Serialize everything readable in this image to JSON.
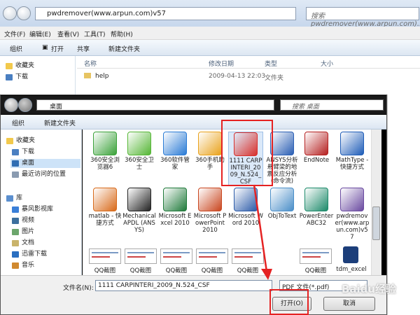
{
  "back_window": {
    "address": "pwdremover(www.arpun.com)v57",
    "search_placeholder": "搜索 pwdremover(www.arpun.com)...",
    "menu": [
      "文件(F)",
      "编辑(E)",
      "查看(V)",
      "工具(T)",
      "帮助(H)"
    ],
    "toolbar": {
      "organize": "组织",
      "open": "打开",
      "share": "共享",
      "new_folder": "新建文件夹"
    },
    "sidebar": [
      "收藏夹",
      "下载"
    ],
    "columns": {
      "name": "名称",
      "modified": "修改日期",
      "type": "类型",
      "size": "大小"
    },
    "rows": [
      {
        "name": "help",
        "modified": "2009-04-13 22:03",
        "type": "文件夹"
      }
    ]
  },
  "dialog": {
    "address": "桌面",
    "search_placeholder": "搜索 桌面",
    "toolbar": {
      "organize": "组织",
      "new_folder": "新建文件夹"
    },
    "sidebar": {
      "favorites_title": "收藏夹",
      "favorites": [
        "下载",
        "桌面",
        "最近访问的位置"
      ],
      "library_title": "库",
      "libraries": [
        "暴风影视库",
        "视频",
        "图片",
        "文档",
        "迅雷下载",
        "音乐"
      ]
    },
    "items": [
      {
        "label": "360安全浏览器6",
        "color": "#3ba23a"
      },
      {
        "label": "360安全卫士",
        "color": "#55b635"
      },
      {
        "label": "360软件管家",
        "color": "#2a7bd5"
      },
      {
        "label": "360手机助手",
        "color": "#e9a21c"
      },
      {
        "label": "1111 CARPINTERI_2009_N.524_CSF",
        "color": "#d8302c"
      },
      {
        "label": "ANSYS分析悬臂梁的地震反应分析(命令流)",
        "color": "#2b5fb4"
      },
      {
        "label": "EndNote",
        "color": "#b52020"
      },
      {
        "label": "MathType - 快捷方式",
        "color": "#1f5db8"
      },
      {
        "label": "matlab - 快捷方式",
        "color": "#d86a1a"
      },
      {
        "label": "Mechanical APDL (ANSYS)",
        "color": "#222222"
      },
      {
        "label": "Microsoft Excel 2010",
        "color": "#1f7a3a"
      },
      {
        "label": "Microsoft PowerPoint 2010",
        "color": "#c9461f"
      },
      {
        "label": "Microsoft Word 2010",
        "color": "#2a5aa8"
      },
      {
        "label": "ObjToText",
        "color": "#4a8ec8"
      },
      {
        "label": "PowerEnterABC32",
        "color": "#1c8a6a"
      },
      {
        "label": "pwdremover(www.arpun.com)v57",
        "color": "#6a4aa0"
      }
    ],
    "thumb_labels": [
      "QQ截图",
      "QQ截图",
      "QQ截图",
      "QQ截图",
      "QQ截图",
      "QQ截图",
      "tdm_excel"
    ],
    "filename_label": "文件名(N):",
    "filename": "1111 CARPINTERI_2009_N.524_CSF",
    "filetype": "PDF 文件(*.pdf)",
    "open_button": "打开(O)",
    "cancel_button": "取消"
  },
  "watermark": "Baidu经验",
  "colors": {
    "highlight": "#e52222",
    "selection": "#cde3f8",
    "toolbar": "#dce6f2"
  }
}
